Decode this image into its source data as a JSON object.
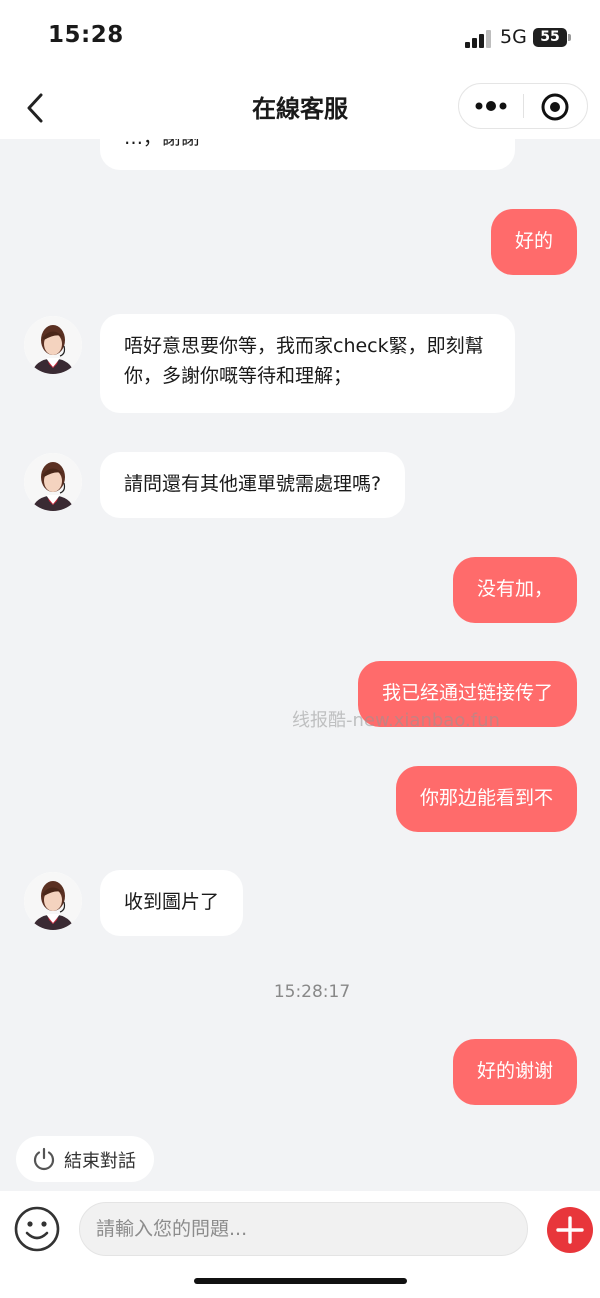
{
  "status_bar": {
    "time": "15:28",
    "network": "5G",
    "battery": "55"
  },
  "nav": {
    "title": "在線客服"
  },
  "messages": [
    {
      "side": "in",
      "text": "…，謝謝"
    },
    {
      "side": "out",
      "text": "好的"
    },
    {
      "side": "in",
      "text": "唔好意思要你等，我而家check緊，即刻幫你，多謝你嘅等待和理解；"
    },
    {
      "side": "in",
      "text": "請問還有其他運單號需處理嗎?"
    },
    {
      "side": "out",
      "text": "没有加，"
    },
    {
      "side": "out",
      "text": "我已经通过链接传了"
    },
    {
      "side": "out",
      "text": "你那边能看到不"
    },
    {
      "side": "in",
      "text": "收到圖片了"
    },
    {
      "side": "out",
      "text": "好的谢谢"
    }
  ],
  "timestamp": "15:28:17",
  "watermark": "线报酷-new.xianbao.fun",
  "end_chat": {
    "label": "結束對話"
  },
  "input": {
    "placeholder": "請輸入您的問題..."
  },
  "colors": {
    "accent": "#ff6b6b",
    "add_button": "#e8363b",
    "background": "#f2f3f5"
  }
}
